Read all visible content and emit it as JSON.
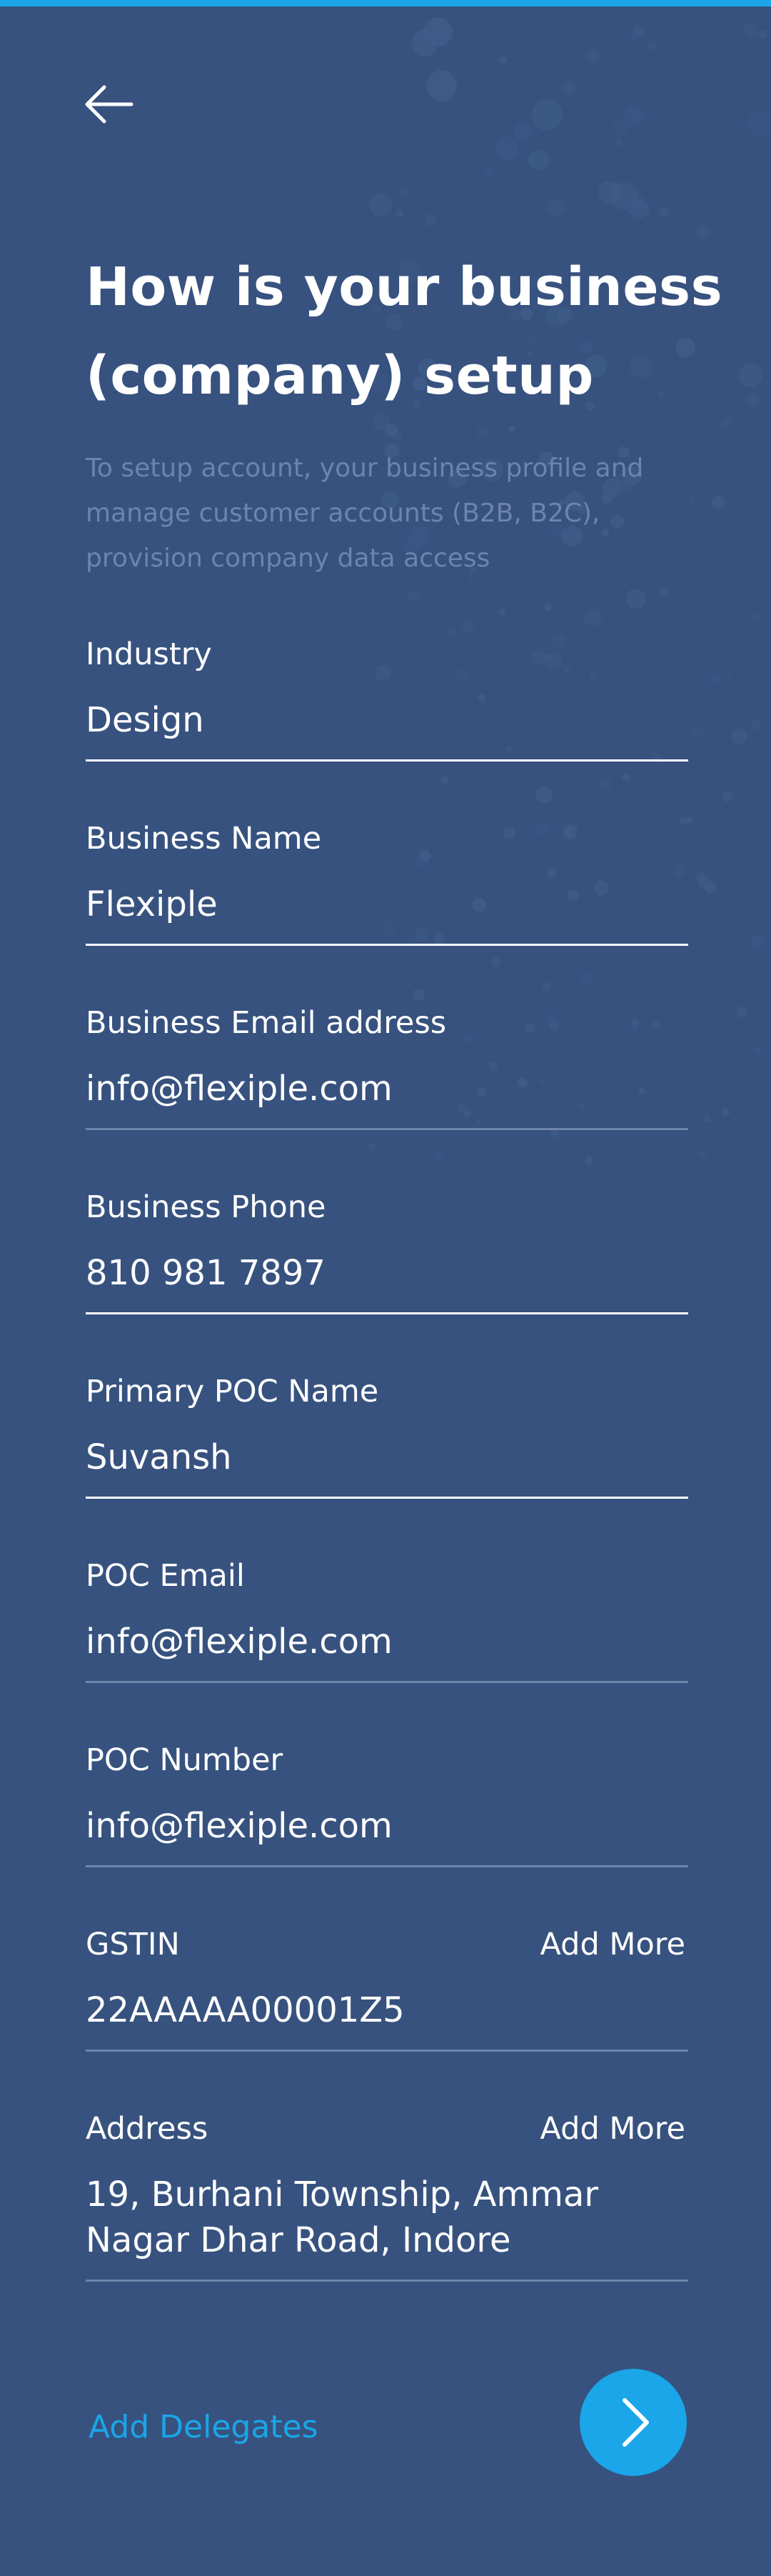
{
  "header": {
    "title": "How is your business (company) setup",
    "subtitle": "To setup account,  your business profile and manage customer accounts (B2B, B2C), provision company data access"
  },
  "icons": {
    "back": "arrow-left-icon",
    "next": "chevron-right-icon"
  },
  "form": {
    "industry": {
      "label": "Industry",
      "value": "Design"
    },
    "business_name": {
      "label": "Business Name",
      "value": "Flexiple"
    },
    "business_email": {
      "label": "Business Email address",
      "value": "info@flexiple.com"
    },
    "business_phone": {
      "label": "Business Phone",
      "value": "810 981 7897"
    },
    "poc_name": {
      "label": "Primary POC Name",
      "value": "Suvansh"
    },
    "poc_email": {
      "label": "POC Email",
      "value": "info@flexiple.com"
    },
    "poc_number": {
      "label": "POC Number",
      "value": "info@flexiple.com"
    },
    "gstin": {
      "label": "GSTIN",
      "value": "22AAAAA00001Z5",
      "action": "Add More"
    },
    "address": {
      "label": "Address",
      "value": "19, Burhani Township, Ammar Nagar Dhar Road, Indore",
      "action": "Add More"
    }
  },
  "footer": {
    "delegates_label": "Add Delegates"
  },
  "colors": {
    "background": "#37527f",
    "accent": "#1aa6e8",
    "muted_text": "#6d84ad",
    "text": "#ffffff"
  }
}
